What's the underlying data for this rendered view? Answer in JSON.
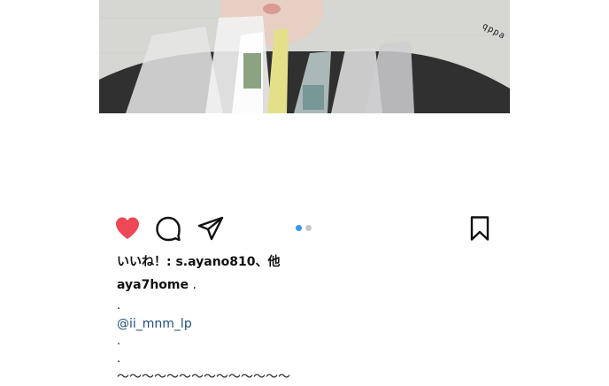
{
  "photo": {
    "alt": "Person holding clear plastic bags with merchandise",
    "caption": "qppa skkcn"
  },
  "actions": {
    "like_icon": "heart-icon",
    "comment_icon": "comment-bubble-icon",
    "share_icon": "paper-plane-icon",
    "save_icon": "bookmark-icon",
    "like_color": "#ed4956",
    "active_dot_color": "#3897f0"
  },
  "carousel": {
    "pages": 2,
    "current": 1
  },
  "post": {
    "likes_text": "いいね！: s.ayano810、他",
    "author": "aya7home",
    "author_suffix": " .",
    "lines": [
      ".",
      "@ii_mnm_lp",
      ".",
      "."
    ],
    "cut_line": "〜〜〜〜〜〜〜〜〜〜〜〜〜〜"
  },
  "colors": {
    "background": "#ffffff",
    "text": "#111111",
    "mention": "#1f4e79"
  }
}
